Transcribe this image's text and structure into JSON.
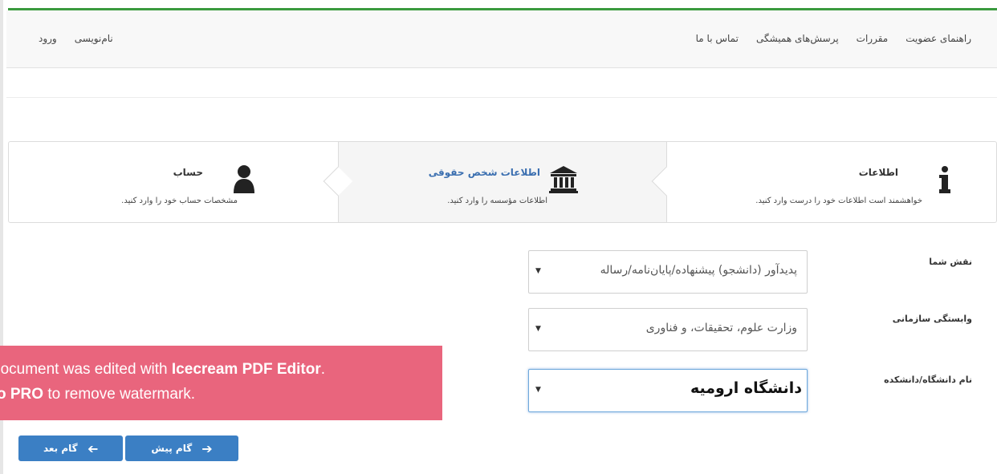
{
  "nav": {
    "right": [
      "راهنمای عضویت",
      "مقررات",
      "پرسش‌های همیشگی",
      "تماس با ما"
    ],
    "left": [
      "نام‌نویسی",
      "ورود"
    ]
  },
  "steps": {
    "info": {
      "title": "اطلاعات",
      "desc": "خواهشمند است اطلاعات خود را درست وارد کنید.",
      "icon": "info-icon"
    },
    "legal": {
      "title": "اطلاعات شخص حقوقی",
      "desc": "اطلاعات مؤسسه را وارد کنید.",
      "icon": "institution-icon"
    },
    "account": {
      "title": "حساب",
      "desc": "مشخصات حساب خود را  وارد کنید.",
      "icon": "user-icon"
    }
  },
  "form": {
    "role": {
      "label": "نقش شما",
      "value": "پدیدآور (دانشجو) پیشنهاده/پایان‌نامه/رساله"
    },
    "affiliation": {
      "label": "وابستگی سازمانی",
      "value": "وزارت علوم، تحقیقات، و فناوری"
    },
    "university": {
      "label": "نام دانشگاه/دانشکده",
      "value": "دانشگاه ارومیه"
    }
  },
  "watermark": {
    "line1_pre": "document was edited with ",
    "line1_bold": "Icecream PDF Editor",
    "line1_post": ".",
    "line2_bold": "o PRO",
    "line2_post": " to remove watermark."
  },
  "buttons": {
    "prev": "گام پیش",
    "next": "گام بعد"
  },
  "colors": {
    "accent_green": "#3a9a3e",
    "button_blue": "#3b7fc4",
    "watermark_pink": "#e9657d"
  }
}
